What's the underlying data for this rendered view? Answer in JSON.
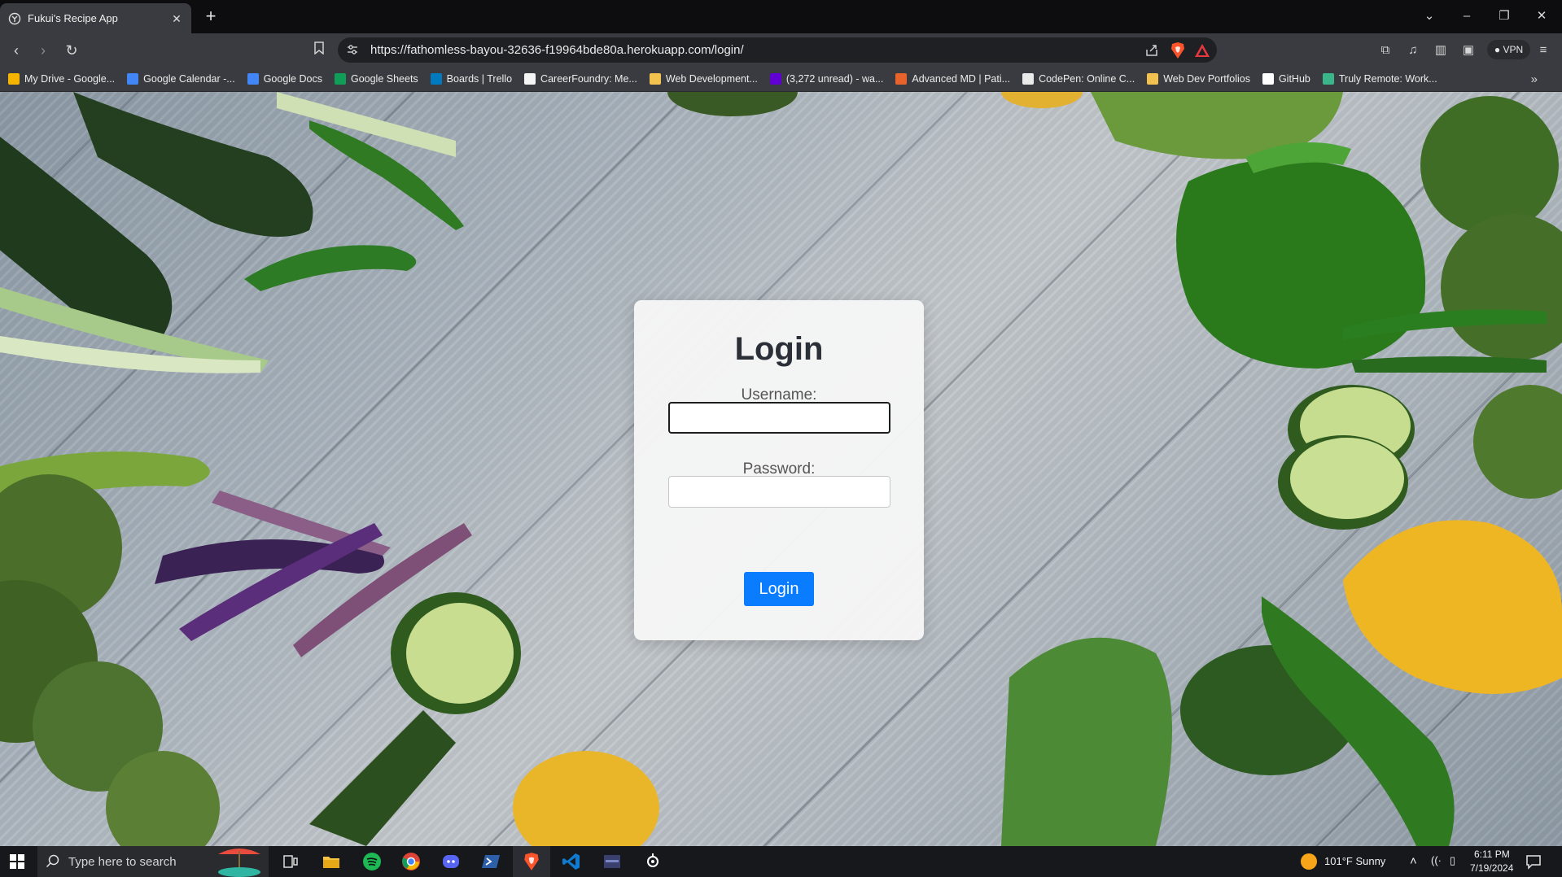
{
  "browser": {
    "tab_title": "Fukui's Recipe App",
    "new_tab": "+",
    "close_tab": "✕",
    "url": "https://fathomless-bayou-32636-f19964bde80a.herokuapp.com/login/",
    "vpn_label": "VPN"
  },
  "bookmarks": [
    {
      "label": "My Drive - Google...",
      "color": "#f4b400"
    },
    {
      "label": "Google Calendar -...",
      "color": "#4285f4"
    },
    {
      "label": "Google Docs",
      "color": "#4285f4"
    },
    {
      "label": "Google Sheets",
      "color": "#0f9d58"
    },
    {
      "label": "Boards | Trello",
      "color": "#0079bf"
    },
    {
      "label": "CareerFoundry: Me...",
      "color": "#f5f5f5"
    },
    {
      "label": "Web Development...",
      "color": "#f2c14e"
    },
    {
      "label": "(3,272 unread) - wa...",
      "color": "#6001d2"
    },
    {
      "label": "Advanced MD | Pati...",
      "color": "#e8632b"
    },
    {
      "label": "CodePen: Online C...",
      "color": "#eaeaea"
    },
    {
      "label": "Web Dev Portfolios",
      "color": "#f2c14e"
    },
    {
      "label": "GitHub",
      "color": "#ffffff"
    },
    {
      "label": "Truly Remote: Work...",
      "color": "#3bb58a"
    }
  ],
  "login": {
    "title": "Login",
    "username_label": "Username:",
    "username_value": "",
    "password_label": "Password:",
    "password_value": "",
    "button_label": "Login"
  },
  "taskbar": {
    "search_placeholder": "Type here to search",
    "weather": "101°F  Sunny",
    "time": "6:11 PM",
    "date": "7/19/2024"
  },
  "colors": {
    "accent": "#0a7cff",
    "brave_orange": "#fb542b"
  }
}
